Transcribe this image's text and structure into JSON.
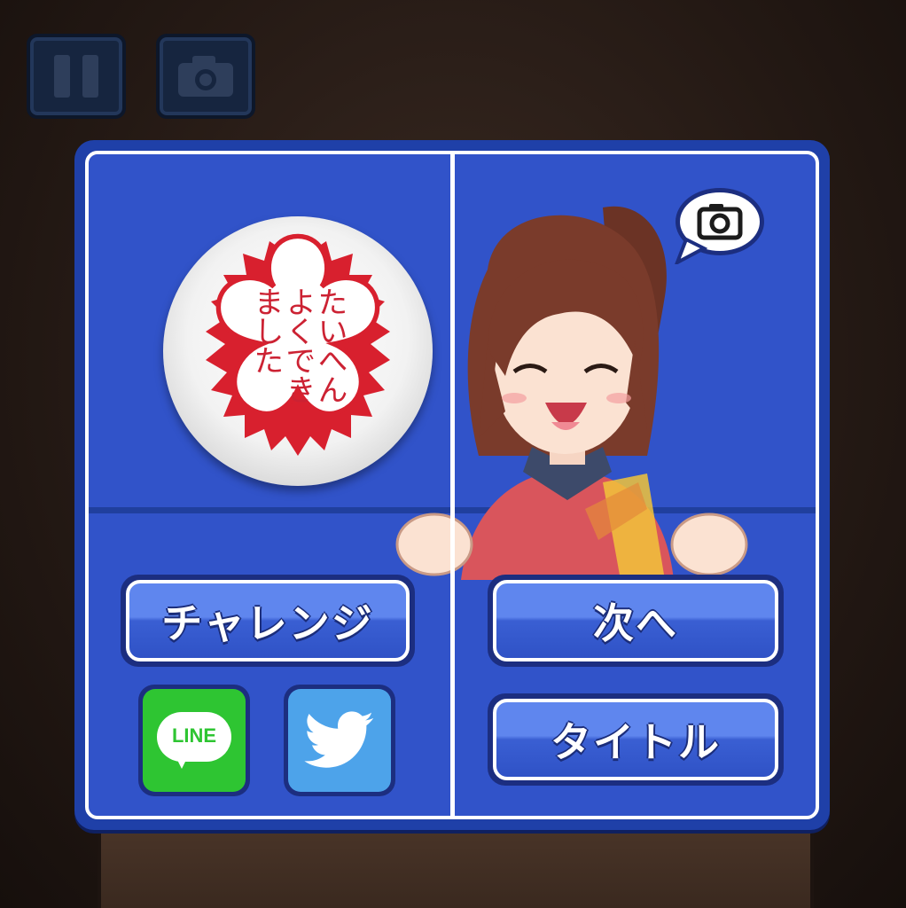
{
  "toolbar": {
    "pause_icon": "pause-icon",
    "camera_icon": "camera-icon"
  },
  "result": {
    "stamp_text": "たいへんよくできました",
    "stamp_color": "#cc2233"
  },
  "character": {
    "speech_icon": "camera-icon"
  },
  "buttons": {
    "challenge": "チャレンジ",
    "next": "次へ",
    "title": "タイトル"
  },
  "share": {
    "line_label": "LINE",
    "twitter_icon": "twitter-bird-icon"
  },
  "colors": {
    "panel": "#3153c9",
    "line_green": "#2ec532",
    "twitter_blue": "#4da3ea"
  }
}
